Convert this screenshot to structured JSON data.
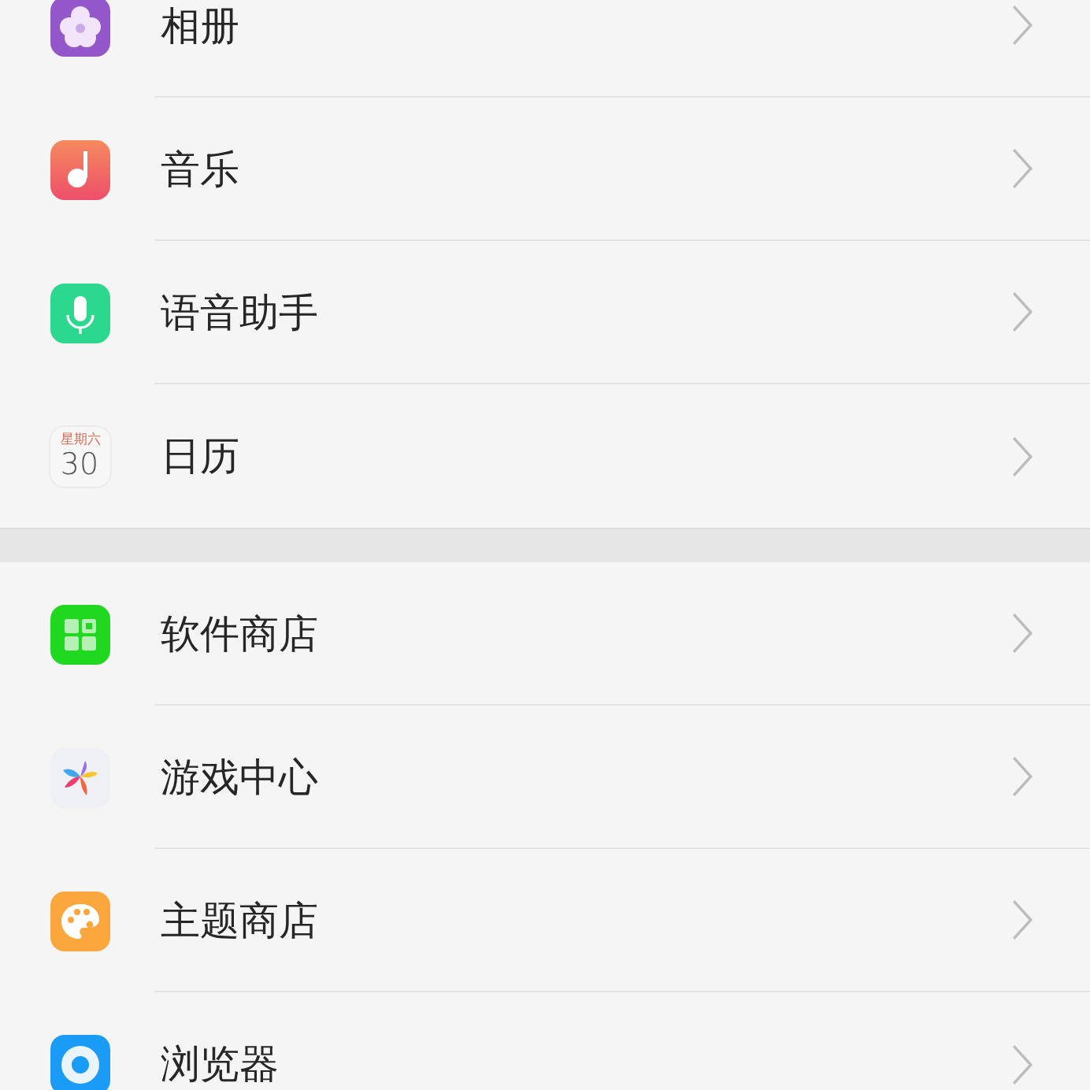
{
  "groups": [
    {
      "items": [
        {
          "label": "相册",
          "kind": "album"
        },
        {
          "label": "音乐",
          "kind": "music"
        },
        {
          "label": "语音助手",
          "kind": "voice"
        },
        {
          "label": "日历",
          "kind": "calendar",
          "weekday": "星期六",
          "day": "30"
        }
      ]
    },
    {
      "items": [
        {
          "label": "软件商店",
          "kind": "store"
        },
        {
          "label": "游戏中心",
          "kind": "game"
        },
        {
          "label": "主题商店",
          "kind": "theme"
        },
        {
          "label": "浏览器",
          "kind": "browser"
        }
      ]
    }
  ]
}
